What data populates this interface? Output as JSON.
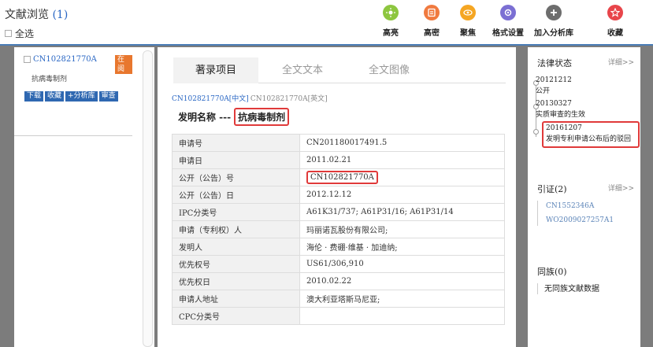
{
  "header": {
    "title": "文献浏览",
    "count": "(1)",
    "select_all": "全选",
    "tools": [
      {
        "icon": "highlight-icon",
        "label": "高亮",
        "color": "#8dc63f"
      },
      {
        "icon": "dense-icon",
        "label": "高密",
        "color": "#f07a3f"
      },
      {
        "icon": "focus-icon",
        "label": "聚焦",
        "color": "#f5a623"
      },
      {
        "icon": "format-settings-icon",
        "label": "格式设置",
        "color": "#7b6fd3"
      },
      {
        "icon": "add-icon",
        "label": "加入分析库",
        "color": "#6d6d6d"
      },
      {
        "icon": "star-icon",
        "label": "收藏",
        "color": "#e8454a"
      }
    ]
  },
  "result": {
    "id": "CN102821770A",
    "status": "在阅",
    "name": "抗病毒制剂",
    "buttons": [
      "下载",
      "收藏",
      "+分析库",
      "审查"
    ]
  },
  "detail": {
    "tabs": [
      "著录项目",
      "全文文本",
      "全文图像"
    ],
    "lang_cn": "CN102821770A[中文]",
    "lang_en": "CN102821770A[英文]",
    "invention_label": "发明名称 ---",
    "invention_name": "抗病毒制剂",
    "rows": [
      {
        "k": "申请号",
        "v": "CN201180017491.5"
      },
      {
        "k": "申请日",
        "v": "2011.02.21"
      },
      {
        "k": "公开（公告）号",
        "v": "CN102821770A"
      },
      {
        "k": "公开（公告）日",
        "v": "2012.12.12"
      },
      {
        "k": "IPC分类号",
        "v": "A61K31/737; A61P31/16; A61P31/14"
      },
      {
        "k": "申请（专利权）人",
        "v": "玛丽诺瓦股份有限公司;"
      },
      {
        "k": "发明人",
        "v": "海伦 · 费硼·维基 · 加迪纳;"
      },
      {
        "k": "优先权号",
        "v": "US61/306,910"
      },
      {
        "k": "优先权日",
        "v": "2010.02.22"
      },
      {
        "k": "申请人地址",
        "v": "澳大利亚塔斯马尼亚;"
      },
      {
        "k": "CPC分类号",
        "v": ""
      }
    ]
  },
  "legal": {
    "heading": "法律状态",
    "detail": "详细>>",
    "events": [
      {
        "date": "20121212",
        "text": "公开"
      },
      {
        "date": "20130327",
        "text": "实质审查的生效"
      },
      {
        "date": "20161207",
        "text": "发明专利申请公布后的驳回"
      }
    ]
  },
  "citations": {
    "heading": "引证(2)",
    "detail": "详细>>",
    "items": [
      "CN1552346A",
      "WO2009027257A1"
    ]
  },
  "family": {
    "heading": "同族(0)",
    "empty": "无同族文献数据"
  }
}
